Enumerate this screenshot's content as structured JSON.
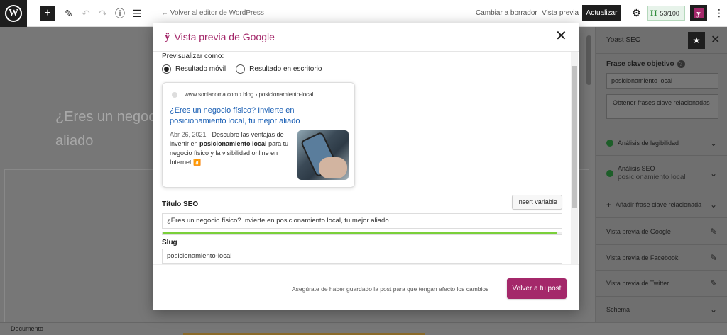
{
  "toolbar": {
    "logo_letter": "W",
    "add_icon": "plus-icon",
    "back_label": "← Volver al editor de WordPress",
    "switch_draft": "Cambiar a borrador",
    "preview": "Vista previa",
    "update": "Actualizar",
    "score_letter": "H",
    "score": "53/100",
    "yoast_letter": "y"
  },
  "editor": {
    "title_fragment": "¿Eres un negoc… aliado"
  },
  "sidebar": {
    "title": "Yoast SEO",
    "keyphrase_label": "Frase clave objetivo",
    "keyphrase_value": "posicionamiento local",
    "related_button": "Obtener frases clave relacionadas",
    "readability": "Análisis de legibilidad",
    "seo_analysis": "Análisis SEO",
    "seo_keyphrase": "posicionamiento local",
    "add_related": "Añadir frase clave relacionada",
    "google_preview": "Vista previa de Google",
    "facebook_preview": "Vista previa de Facebook",
    "twitter_preview": "Vista previa de Twitter",
    "schema": "Schema"
  },
  "status_bar": {
    "label": "Documento"
  },
  "modal": {
    "title": "Vista previa de Google",
    "preview_as": "Previsualizar como:",
    "mode_mobile": "Resultado móvil",
    "mode_desktop": "Resultado en escritorio",
    "selected_mode": "mobile",
    "serp": {
      "breadcrumb": "www.soniacoma.com › blog › posicionamiento-local",
      "title": "¿Eres un negocio físico? Invierte en posicionamiento local, tu mejor aliado",
      "date": "Abr 26, 2021",
      "desc_part1": " · Descubre las ventajas de invertir en ",
      "desc_bold": "posicionamiento local",
      "desc_part2": " para tu negocio físico y la visibilidad online en Internet.",
      "desc_emoji": "📶"
    },
    "seo_title_label": "Título SEO",
    "insert_variable": "Insert variable",
    "seo_title_value": "¿Eres un negocio físico? Invierte en posicionamiento local, tu mejor aliado",
    "seo_title_progress": 0.99,
    "slug_label": "Slug",
    "slug_value": "posicionamiento-local",
    "footer_note": "Asegúrate de haber guardado la post para que tengan efecto los cambios",
    "return_button": "Volver a tu post"
  },
  "colors": {
    "yoast_brand": "#a4286a",
    "progress_good": "#7ad03a",
    "serp_link": "#1a5fb4"
  }
}
